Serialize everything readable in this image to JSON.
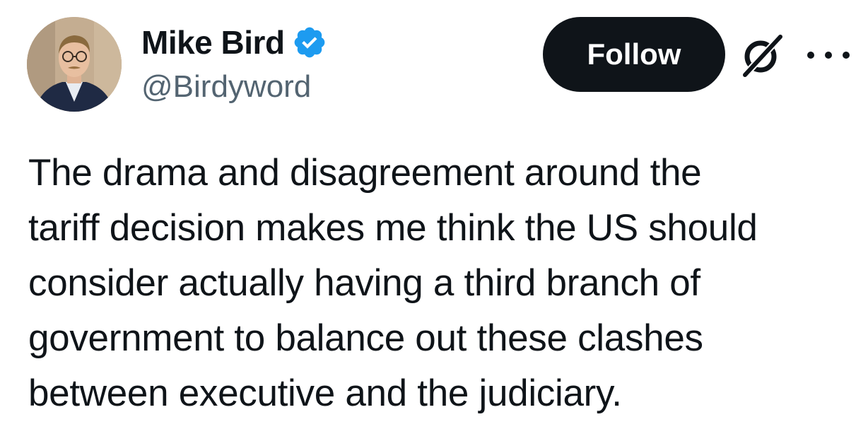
{
  "author": {
    "display_name": "Mike Bird",
    "handle": "@Birdyword",
    "verified": true,
    "verified_color": "#1d9bf0",
    "avatar_icon": "profile-photo"
  },
  "actions": {
    "follow_label": "Follow",
    "grok_icon": "grok-icon",
    "more_icon": "more-options-icon"
  },
  "tweet": {
    "text_lines": [
      "The drama and disagreement around the",
      "tariff decision makes me think the US should",
      "consider actually having a third branch of",
      "government to balance out these clashes",
      "between executive and the judiciary."
    ]
  },
  "colors": {
    "text_primary": "#0f1419",
    "text_secondary": "#536471",
    "button_bg": "#0f1419",
    "button_text": "#ffffff"
  }
}
